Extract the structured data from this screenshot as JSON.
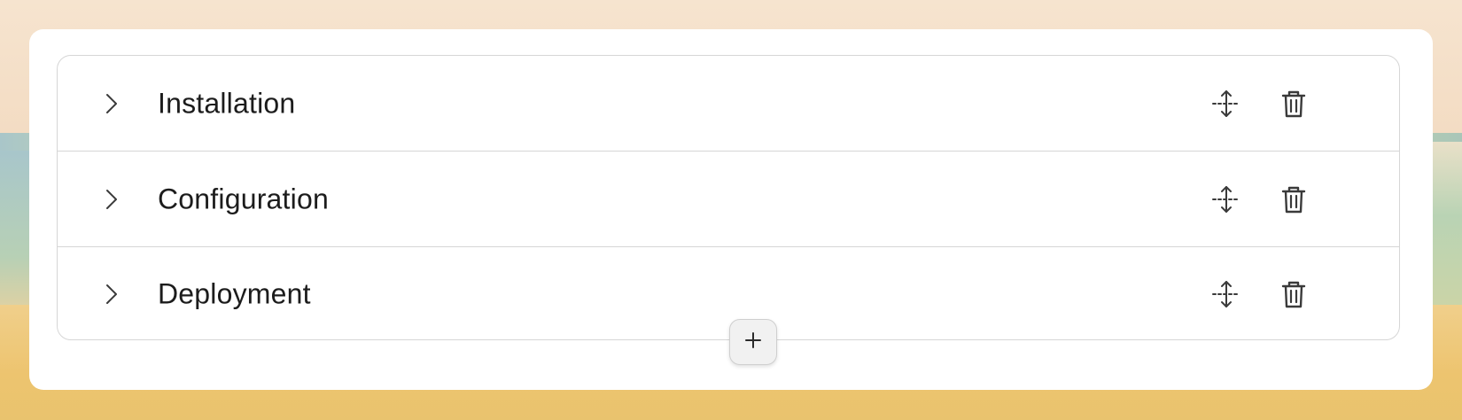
{
  "accordion": {
    "items": [
      {
        "label": "Installation"
      },
      {
        "label": "Configuration"
      },
      {
        "label": "Deployment"
      }
    ]
  },
  "icons": {
    "expand": "chevron-right-icon",
    "reorder": "drag-move-icon",
    "delete": "trash-icon",
    "add": "plus-icon"
  },
  "colors": {
    "text": "#1c1c1c",
    "icon": "#3a3a3a",
    "border": "#d6d6d6",
    "panel": "#ffffff"
  }
}
